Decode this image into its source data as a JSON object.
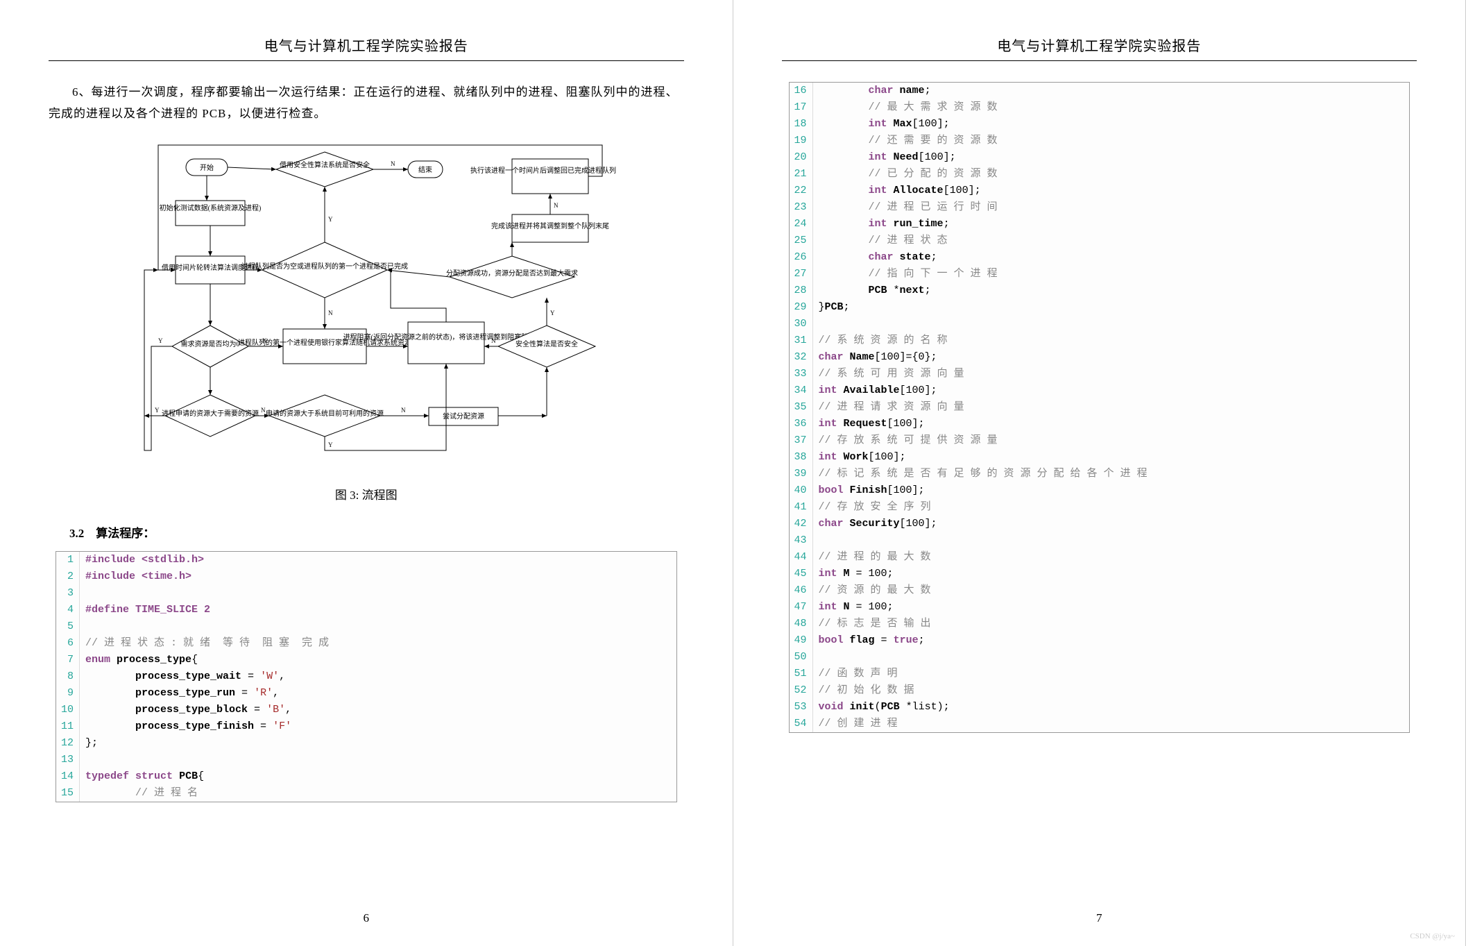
{
  "header": "电气与计算机工程学院实验报告",
  "left": {
    "para": "6、每进行一次调度，程序都要输出一次运行结果：正在运行的进程、就绪队列中的进程、阻塞队列中的进程、完成的进程以及各个进程的 PCB，以便进行检查。",
    "caption": "图 3: 流程图",
    "section": "3.2　算法程序：",
    "page_number": "6"
  },
  "right": {
    "page_number": "7"
  },
  "flowchart": {
    "start": "开始",
    "safety_check": "借用安全性算法系统是否安全",
    "end_box": "结束",
    "init_data": "初始化测试数据(系统资源及进程)",
    "exec_proc": "执行该进程一个时间片后调整回已完成进程队列前端",
    "complete_proc": "完成该进程并将其调整到整个队列末尾",
    "rr_schedule": "借用时间片轮转法算法调度进程",
    "queue_empty": "进程队列是否为空或进程队列的第一个进程是否已完成",
    "alloc_resource": "分配资源成功，资源分配是否达到最大需求",
    "need_zero": "需求资源是否均为0",
    "first_proc": "进程队列的第一个进程使用银行家算法随机请求系统资源",
    "block_proc": "进程阻塞(返回分配资源之前的状态)，将该进程调整到阻塞队列末尾",
    "safe_check2": "安全性算法是否安全",
    "request_gt": "进程申请的资源大于需要的资源",
    "request_avail": "申请的资源大于系统目前可利用的资源",
    "try_alloc": "尝试分配资源",
    "label_y": "Y",
    "label_n": "N"
  },
  "code_left": [
    {
      "n": 1,
      "raw": "#include <stdlib.h>",
      "cls": "kw"
    },
    {
      "n": 2,
      "raw": "#include <time.h>",
      "cls": "kw"
    },
    {
      "n": 3,
      "raw": ""
    },
    {
      "n": 4,
      "raw": "#define TIME_SLICE 2",
      "cls": "kw"
    },
    {
      "n": 5,
      "raw": ""
    },
    {
      "n": 6,
      "raw": "// 进 程 状 态 : 就 绪  等 待  阻 塞  完 成",
      "cls": "cm"
    },
    {
      "n": 7,
      "raw": "enum process_type{"
    },
    {
      "n": 8,
      "raw": "        process_type_wait = 'W',"
    },
    {
      "n": 9,
      "raw": "        process_type_run = 'R',"
    },
    {
      "n": 10,
      "raw": "        process_type_block = 'B',"
    },
    {
      "n": 11,
      "raw": "        process_type_finish = 'F'"
    },
    {
      "n": 12,
      "raw": "};"
    },
    {
      "n": 13,
      "raw": ""
    },
    {
      "n": 14,
      "raw": "typedef struct PCB{"
    },
    {
      "n": 15,
      "raw": "        // 进 程 名",
      "cls": "cm"
    }
  ],
  "code_right": [
    {
      "n": 16,
      "raw": "        char name;"
    },
    {
      "n": 17,
      "raw": "        // 最 大 需 求 资 源 数",
      "cls": "cm"
    },
    {
      "n": 18,
      "raw": "        int Max[100];"
    },
    {
      "n": 19,
      "raw": "        // 还 需 要 的 资 源 数",
      "cls": "cm"
    },
    {
      "n": 20,
      "raw": "        int Need[100];"
    },
    {
      "n": 21,
      "raw": "        // 已 分 配 的 资 源 数",
      "cls": "cm"
    },
    {
      "n": 22,
      "raw": "        int Allocate[100];"
    },
    {
      "n": 23,
      "raw": "        // 进 程 已 运 行 时 间",
      "cls": "cm"
    },
    {
      "n": 24,
      "raw": "        int run_time;"
    },
    {
      "n": 25,
      "raw": "        // 进 程 状 态",
      "cls": "cm"
    },
    {
      "n": 26,
      "raw": "        char state;"
    },
    {
      "n": 27,
      "raw": "        // 指 向 下 一 个 进 程",
      "cls": "cm"
    },
    {
      "n": 28,
      "raw": "        PCB *next;"
    },
    {
      "n": 29,
      "raw": "}PCB;"
    },
    {
      "n": 30,
      "raw": ""
    },
    {
      "n": 31,
      "raw": "// 系 统 资 源 的 名 称",
      "cls": "cm"
    },
    {
      "n": 32,
      "raw": "char Name[100]={0};"
    },
    {
      "n": 33,
      "raw": "// 系 统 可 用 资 源 向 量",
      "cls": "cm"
    },
    {
      "n": 34,
      "raw": "int Available[100];"
    },
    {
      "n": 35,
      "raw": "// 进 程 请 求 资 源 向 量",
      "cls": "cm"
    },
    {
      "n": 36,
      "raw": "int Request[100];"
    },
    {
      "n": 37,
      "raw": "// 存 放 系 统 可 提 供 资 源 量",
      "cls": "cm"
    },
    {
      "n": 38,
      "raw": "int Work[100];"
    },
    {
      "n": 39,
      "raw": "// 标 记 系 统 是 否 有 足 够 的 资 源 分 配 给 各 个 进 程",
      "cls": "cm"
    },
    {
      "n": 40,
      "raw": "bool Finish[100];"
    },
    {
      "n": 41,
      "raw": "// 存 放 安 全 序 列",
      "cls": "cm"
    },
    {
      "n": 42,
      "raw": "char Security[100];"
    },
    {
      "n": 43,
      "raw": ""
    },
    {
      "n": 44,
      "raw": "// 进 程 的 最 大 数",
      "cls": "cm"
    },
    {
      "n": 45,
      "raw": "int M = 100;"
    },
    {
      "n": 46,
      "raw": "// 资 源 的 最 大 数",
      "cls": "cm"
    },
    {
      "n": 47,
      "raw": "int N = 100;"
    },
    {
      "n": 48,
      "raw": "// 标 志 是 否 输 出",
      "cls": "cm"
    },
    {
      "n": 49,
      "raw": "bool flag = true;"
    },
    {
      "n": 50,
      "raw": ""
    },
    {
      "n": 51,
      "raw": "// 函 数 声 明",
      "cls": "cm"
    },
    {
      "n": 52,
      "raw": "// 初 始 化 数 据",
      "cls": "cm"
    },
    {
      "n": 53,
      "raw": "void init(PCB *list);"
    },
    {
      "n": 54,
      "raw": "// 创 建 进 程",
      "cls": "cm"
    }
  ],
  "watermark": "CSDN @j/ya~"
}
